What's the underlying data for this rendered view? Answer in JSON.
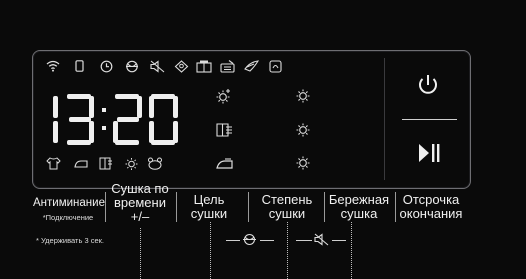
{
  "display": {
    "time": "13:20",
    "top_icons": [
      "wifi-icon",
      "phone-icon",
      "clock-icon",
      "anti-crease-icon",
      "mute-icon",
      "child-lock-icon",
      "wardrobe-icon",
      "iron-dry-icon",
      "delicate-icon",
      "filter-icon"
    ],
    "mid_icons": [
      "extra-dry-icon",
      "dry-level-3-icon",
      "wardrobe-dry-icon",
      "dry-level-2-icon",
      "iron-icon",
      "dry-level-1-icon"
    ],
    "bottom_icons": [
      "shirt-icon",
      "iron-small-icon",
      "cupboard-icon",
      "sun-icon",
      "bear-icon"
    ]
  },
  "labels": {
    "anti_crease": "Антиминание",
    "connect_note": "*Подключение",
    "time_dry": "Сушка по\nвремени\n+/–",
    "target_dry": "Цель\nсушки",
    "dry_level": "Степень\nсушки",
    "gentle_dry": "Бережная\nсушка",
    "delay": "Отсрочка\nокончания"
  },
  "note": "* Удерживать 3 сек.",
  "buttons": {
    "power": "power-icon",
    "play_pause": "play-pause-icon"
  }
}
